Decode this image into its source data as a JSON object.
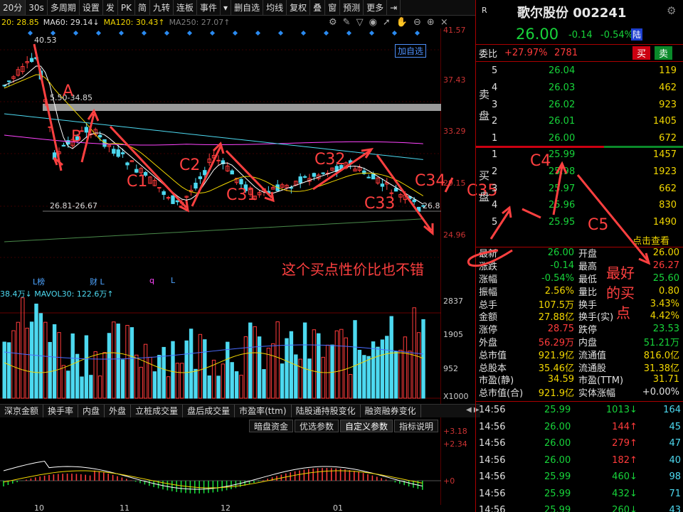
{
  "toolbar": {
    "items": [
      {
        "label": "20分",
        "sel": true
      },
      {
        "label": "30s"
      },
      {
        "label": "多周期"
      },
      {
        "label": "设置"
      },
      {
        "label": "发"
      },
      {
        "label": "PK"
      },
      {
        "label": "简"
      },
      {
        "label": "九转"
      },
      {
        "label": "连板"
      },
      {
        "label": "事件"
      },
      {
        "label": "▾"
      },
      {
        "label": "删自选"
      },
      {
        "label": "均线"
      },
      {
        "label": "复权"
      },
      {
        "label": "叠"
      },
      {
        "label": "窗"
      },
      {
        "label": "预测"
      },
      {
        "label": "更多"
      },
      {
        "label": "⇥"
      }
    ]
  },
  "ma_line": {
    "ma20": "20: 28.85",
    "ma60": "MA60: 29.14↓",
    "ma120": "MA120: 30.43↑",
    "ma250": "MA250: 27.07↑"
  },
  "price_axis": [
    "41.57",
    "37.43",
    "33.29",
    "29.15",
    "24.96"
  ],
  "chart_labels": {
    "high": "40.53",
    "zone": "5.50-34.85",
    "low_zone": "26.81-26.67",
    "right_zone": "26.8",
    "add_fav": "加自选",
    "event_marks": [
      "L榜",
      "财 L",
      "q",
      "L"
    ]
  },
  "annotations": {
    "A": "A",
    "B": "B",
    "C1": "C1",
    "C2": "C2",
    "C31": "C31",
    "C32": "C32",
    "C33": "C33",
    "C34": "C34",
    "C35": "C35",
    "C4": "C4",
    "C5": "C5",
    "note": "这个买点性价比也不错",
    "best": [
      "最好",
      "的买",
      "点"
    ]
  },
  "vol_line": {
    "vol": "38.4万↓",
    "mavol": "MAVOL30: 122.6万↑"
  },
  "vol_axis": [
    "2837",
    "1905",
    "952",
    "X1000"
  ],
  "bottom_tabs": [
    "深京金额",
    "换手率",
    "内盘",
    "外盘",
    "立桩成交量",
    "盘后成交量",
    "市盈率(ttm)",
    "陆股通持股变化",
    "融资融券变化"
  ],
  "sub_tabs": [
    "暗盘资金",
    "优选参数",
    "自定义参数",
    "指标说明"
  ],
  "macd_axis": [
    "+3.18",
    "+2.34",
    "+0"
  ],
  "time_axis": [
    "10",
    "11",
    "12",
    "01"
  ],
  "stock": {
    "badge": "R",
    "name": "歌尔股份 002241",
    "price": "26.00",
    "change": "-0.14",
    "pct": "-0.54%",
    "tag": "陆"
  },
  "wb": {
    "label": "委比",
    "ratio": "+27.97%",
    "diff": "2781",
    "buy": "买",
    "sell": "卖"
  },
  "sell_side": {
    "label": [
      "卖",
      "盘"
    ],
    "rows": [
      {
        "lvl": "5",
        "price": "26.04",
        "vol": "119"
      },
      {
        "lvl": "4",
        "price": "26.03",
        "vol": "462"
      },
      {
        "lvl": "3",
        "price": "26.02",
        "vol": "923"
      },
      {
        "lvl": "2",
        "price": "26.01",
        "vol": "1405"
      },
      {
        "lvl": "1",
        "price": "26.00",
        "vol": "672"
      }
    ]
  },
  "buy_side": {
    "label": [
      "买",
      "盘"
    ],
    "rows": [
      {
        "lvl": "1",
        "price": "25.99",
        "vol": "1457"
      },
      {
        "lvl": "2",
        "price": "25.98",
        "vol": "1923"
      },
      {
        "lvl": "3",
        "price": "25.97",
        "vol": "662"
      },
      {
        "lvl": "4",
        "price": "25.96",
        "vol": "830"
      },
      {
        "lvl": "5",
        "price": "25.95",
        "vol": "1490"
      }
    ]
  },
  "click_view": "点击查看",
  "stats": [
    [
      "最新",
      "26.00",
      "开盘",
      "26.00"
    ],
    [
      "涨跌",
      "-0.14",
      "最高",
      "26.27"
    ],
    [
      "涨幅",
      "-0.54%",
      "最低",
      "25.60"
    ],
    [
      "振幅",
      "2.56%",
      "量比",
      "0.80"
    ],
    [
      "总手",
      "107.5万",
      "换手",
      "3.43%"
    ],
    [
      "金额",
      "27.88亿",
      "换手(实)",
      "4.42%"
    ],
    [
      "涨停",
      "28.75",
      "跌停",
      "23.53"
    ],
    [
      "外盘",
      "56.29万",
      "内盘",
      "51.21万"
    ],
    [
      "总市值",
      "921.9亿",
      "流通值",
      "816.0亿"
    ],
    [
      "总股本",
      "35.46亿",
      "流通股",
      "31.38亿"
    ],
    [
      "市盈(静)",
      "34.59",
      "市盈(TTM)",
      "31.71"
    ],
    [
      "总市值(合)",
      "921.9亿",
      "实体涨幅",
      "+0.00%"
    ]
  ],
  "ticks": [
    {
      "time": "14:56",
      "price": "25.99",
      "vol": "1013",
      "dir": "down",
      "n": "164"
    },
    {
      "time": "14:56",
      "price": "26.00",
      "vol": "144",
      "dir": "up",
      "n": "45"
    },
    {
      "time": "14:56",
      "price": "26.00",
      "vol": "279",
      "dir": "up",
      "n": "47"
    },
    {
      "time": "14:56",
      "price": "26.00",
      "vol": "182",
      "dir": "up",
      "n": "40"
    },
    {
      "time": "14:56",
      "price": "25.99",
      "vol": "460",
      "dir": "down",
      "n": "98"
    },
    {
      "time": "14:56",
      "price": "25.99",
      "vol": "432",
      "dir": "down",
      "n": "71"
    },
    {
      "time": "14:56",
      "price": "25.99",
      "vol": "260",
      "dir": "down",
      "n": "43"
    }
  ],
  "colors": {
    "up": "#ff3b3b",
    "down": "#17d43a",
    "cyan": "#4dd9f0",
    "annot": "#ff4040"
  }
}
